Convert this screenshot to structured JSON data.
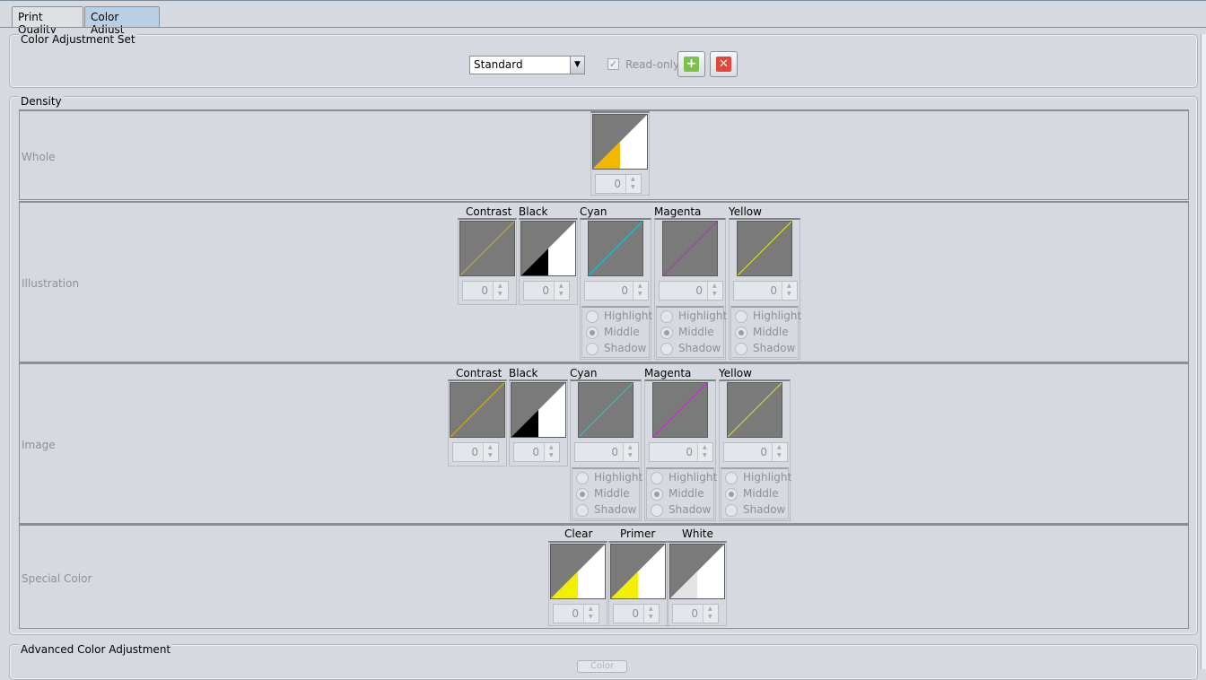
{
  "tabs": [
    {
      "label": "Print Quality",
      "active": false
    },
    {
      "label": "Color Adjust",
      "active": true
    }
  ],
  "color_adjustment_set": {
    "legend": "Color Adjustment Set",
    "selected": "Standard",
    "readonly_label": "Read-only",
    "readonly_checked": true,
    "add_icon": "plus-icon",
    "delete_icon": "x-icon"
  },
  "density": {
    "legend": "Density",
    "rows": {
      "whole": {
        "label": "Whole",
        "value": "0"
      },
      "illustration": {
        "label": "Illustration",
        "contrast": {
          "label": "Contrast",
          "value": "0"
        },
        "black": {
          "label": "Black",
          "value": "0"
        },
        "cyan": {
          "label": "Cyan",
          "value": "0"
        },
        "magenta": {
          "label": "Magenta",
          "value": "0"
        },
        "yellow": {
          "label": "Yellow",
          "value": "0"
        }
      },
      "image": {
        "label": "Image",
        "contrast": {
          "label": "Contrast",
          "value": "0"
        },
        "black": {
          "label": "Black",
          "value": "0"
        },
        "cyan": {
          "label": "Cyan",
          "value": "0"
        },
        "magenta": {
          "label": "Magenta",
          "value": "0"
        },
        "yellow": {
          "label": "Yellow",
          "value": "0"
        }
      },
      "special": {
        "label": "Special Color",
        "clear": {
          "label": "Clear",
          "value": "0"
        },
        "primer": {
          "label": "Primer",
          "value": "0"
        },
        "white": {
          "label": "White",
          "value": "0"
        }
      }
    },
    "tone_options": {
      "highlight": "Highlight",
      "middle": "Middle",
      "shadow": "Shadow",
      "selected": "Middle"
    }
  },
  "advanced": {
    "legend": "Advanced Color Adjustment",
    "button_label": "Color"
  },
  "colors": {
    "cyan": "#00d8d8",
    "magenta": "#d020d0",
    "yellow": "#f0f000",
    "contrast": "#e0b800",
    "whole_fill": "#f0b800",
    "tab_active": "#b8cfe5"
  }
}
